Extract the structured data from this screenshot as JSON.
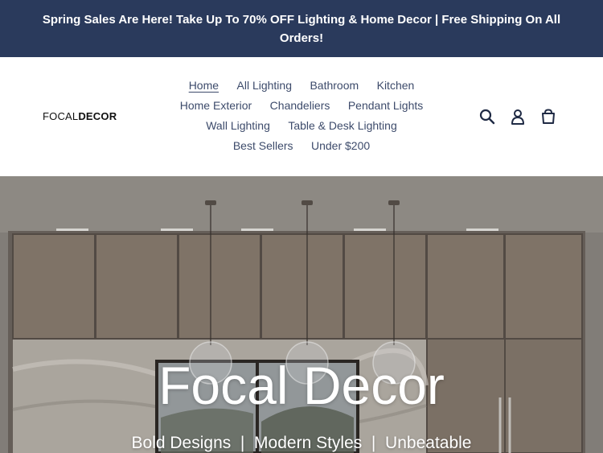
{
  "announcement": {
    "text": "Spring Sales Are Here! Take Up To 70% OFF Lighting & Home Decor | Free Shipping On All Orders!"
  },
  "logo": {
    "part1": "FOCAL",
    "part2": "DECOR"
  },
  "nav": {
    "rows": [
      [
        "Home",
        "All Lighting",
        "Bathroom",
        "Kitchen"
      ],
      [
        "Home Exterior",
        "Chandeliers",
        "Pendant Lights"
      ],
      [
        "Wall Lighting",
        "Table & Desk Lighting"
      ],
      [
        "Best Sellers",
        "Under $200"
      ]
    ],
    "active": "Home"
  },
  "header_icons": [
    "search-icon",
    "account-icon",
    "cart-icon"
  ],
  "hero": {
    "title": "Focal Decor",
    "subtitle": "Bold Designs  |  Modern Styles  |  Unbeatable"
  },
  "colors": {
    "announcement_bg": "#2a3a5c",
    "nav_text": "#3d4b6b"
  }
}
